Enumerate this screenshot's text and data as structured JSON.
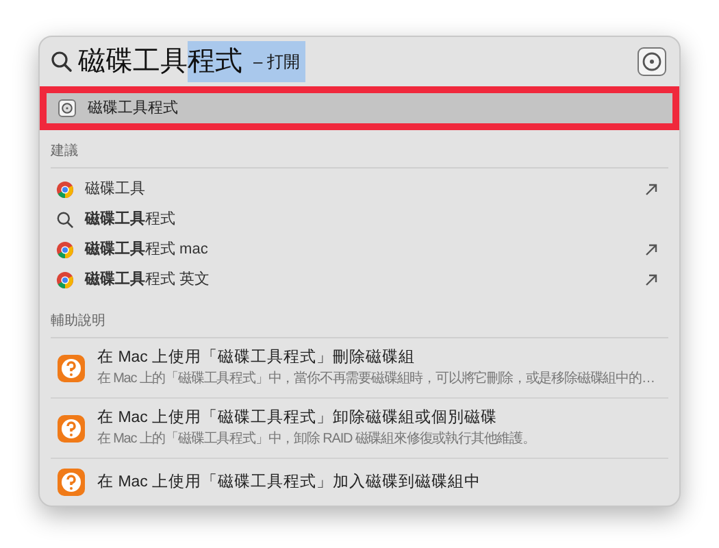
{
  "search": {
    "typed": "磁碟工具",
    "completion": "程式",
    "hint": "– 打開"
  },
  "top_hit": {
    "label": "磁碟工具程式",
    "selected": true
  },
  "suggestions": {
    "heading": "建議",
    "items": [
      {
        "kind": "web",
        "text": "磁碟工具",
        "arrow": true
      },
      {
        "kind": "search",
        "text": "**磁碟工具**程式",
        "arrow": false
      },
      {
        "kind": "web",
        "text": "**磁碟工具**程式 mac",
        "arrow": true
      },
      {
        "kind": "web",
        "text": "**磁碟工具**程式 英文",
        "arrow": true
      }
    ]
  },
  "help": {
    "heading": "輔助說明",
    "items": [
      {
        "title": "在 Mac 上使用「磁碟工具程式」刪除磁碟組",
        "subtitle": "在 Mac 上的「磁碟工具程式」中，當你不再需要磁碟組時，可以將它刪除，或是移除磁碟組中的…"
      },
      {
        "title": "在 Mac 上使用「磁碟工具程式」卸除磁碟組或個別磁碟",
        "subtitle": "在 Mac 上的「磁碟工具程式」中，卸除 RAID 磁碟組來修復或執行其他維護。"
      },
      {
        "title": "在 Mac 上使用「磁碟工具程式」加入磁碟到磁碟組中"
      }
    ]
  }
}
